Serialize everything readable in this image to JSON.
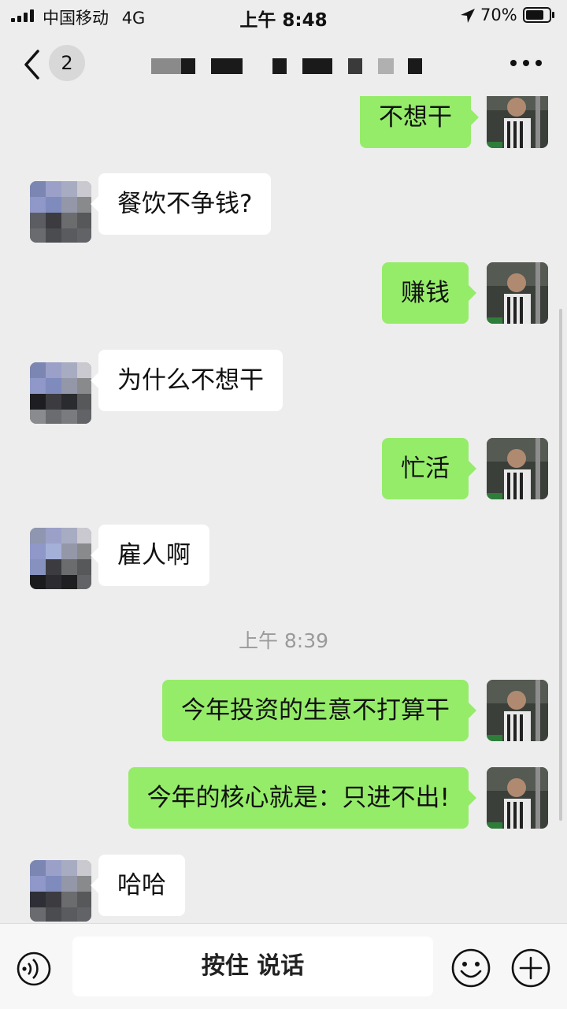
{
  "status_bar": {
    "carrier": "中国移动",
    "network": "4G",
    "time": "上午 8:48",
    "battery": "70%"
  },
  "nav": {
    "unread_count": "2",
    "back_icon": "chevron-left-icon",
    "more_icon": "ellipsis-icon"
  },
  "messages": {
    "m1": "不想干",
    "m2": "餐饮不争钱?",
    "m3": "赚钱",
    "m4": "为什么不想干",
    "m5": "忙活",
    "m6": "雇人啊",
    "time_divider": "上午 8:39",
    "m7": "今年投资的生意不打算干",
    "m8": "今年的核心就是：只进不出!",
    "m9": "哈哈"
  },
  "input_bar": {
    "hold_to_talk": "按住 说话",
    "voice_icon": "voice-icon",
    "emoji_icon": "emoji-icon",
    "plus_icon": "plus-icon"
  },
  "colors": {
    "background": "#ededed",
    "outgoing_bubble": "#95ec69",
    "incoming_bubble": "#ffffff"
  }
}
